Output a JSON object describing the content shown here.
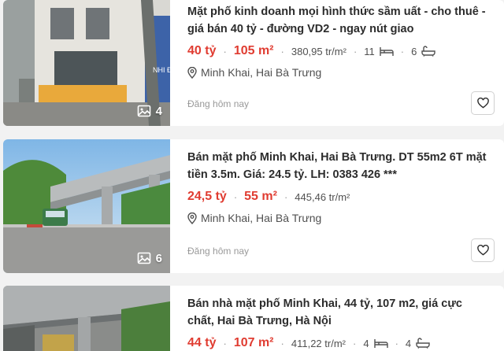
{
  "listings": [
    {
      "title": "Mặt phố kinh doanh mọi hình thức sầm uất - cho thuê - giá bán 40 tỷ - đường VD2 - ngay nút giao",
      "price": "40 tỷ",
      "area": "105 m²",
      "price_per_m2": "380,95 tr/m²",
      "bedrooms": "11",
      "bathrooms": "6",
      "location": "Minh Khai, Hai Bà Trưng",
      "posted": "Đăng hôm nay",
      "photo_count": "4",
      "sign_text": "NHI ĐÌ"
    },
    {
      "title": "Bán mặt phố Minh Khai, Hai Bà Trưng. DT 55m2 6T mặt tiền 3.5m. Giá: 24.5 tỷ. LH: 0383 426 ***",
      "price": "24,5 tỷ",
      "area": "55 m²",
      "price_per_m2": "445,46 tr/m²",
      "location": "Minh Khai, Hai Bà Trưng",
      "posted": "Đăng hôm nay",
      "photo_count": "6"
    },
    {
      "title": "Bán nhà mặt phố Minh Khai, 44 tỷ, 107 m2, giá cực chất, Hai Bà Trưng, Hà Nội",
      "price": "44 tỷ",
      "area": "107 m²",
      "price_per_m2": "411,22 tr/m²",
      "bedrooms": "4",
      "bathrooms": "4"
    }
  ],
  "colors": {
    "price": "#e03c31",
    "background": "#f2f2f2"
  },
  "icons": {
    "bed": "bed-icon",
    "bath": "bathtub-icon",
    "location": "location-pin-icon",
    "photos": "image-icon",
    "favorite": "heart-icon"
  }
}
